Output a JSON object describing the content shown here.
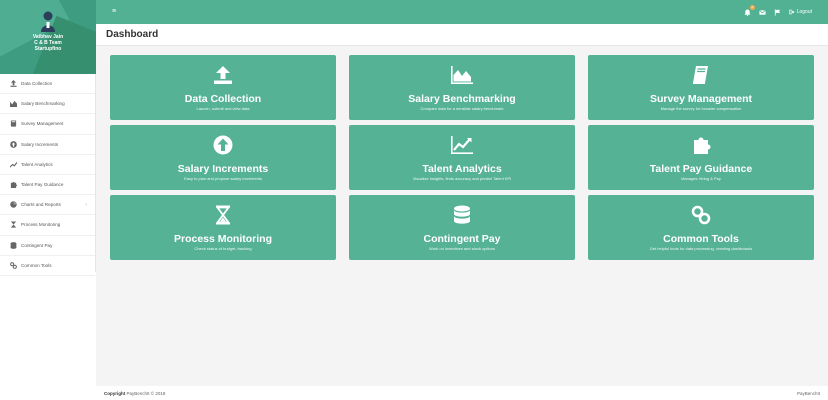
{
  "profile": {
    "name_line1": "Vaibhav Jain",
    "name_line2": "C & B Team",
    "name_line3": "Startupfino"
  },
  "sidebar": {
    "items": [
      {
        "label": "Data Collection",
        "icon": "upload-icon"
      },
      {
        "label": "Salary Benchmarking",
        "icon": "chart-icon"
      },
      {
        "label": "Survey Management",
        "icon": "book-icon"
      },
      {
        "label": "Salary Increments",
        "icon": "circle-up-icon"
      },
      {
        "label": "Talent Analytics",
        "icon": "trend-icon"
      },
      {
        "label": "Talent Pay Guidance",
        "icon": "puzzle-icon"
      },
      {
        "label": "Charts and Reports",
        "icon": "pie-icon",
        "has_submenu": true
      },
      {
        "label": "Process Monitoring",
        "icon": "hourglass-icon"
      },
      {
        "label": "Contingent Pay",
        "icon": "database-icon"
      },
      {
        "label": "Common Tools",
        "icon": "link-icon"
      }
    ],
    "submenu_chevron": "‹"
  },
  "topbar": {
    "menu_glyph": "≡",
    "notification_count": "4",
    "logout_label": "Logout"
  },
  "page": {
    "title": "Dashboard"
  },
  "cards": [
    {
      "title": "Data Collection",
      "desc": "Launch, submit and view data",
      "icon": "upload-icon"
    },
    {
      "title": "Salary Benchmarking",
      "desc": "Compare data for a sensible salary benchmark",
      "icon": "area-chart-icon"
    },
    {
      "title": "Survey Management",
      "desc": "Manage the survey for broader compensation",
      "icon": "book-icon"
    },
    {
      "title": "Salary Increments",
      "desc": "Easy to plan and propose salary increments",
      "icon": "arrow-circle-up-icon"
    },
    {
      "title": "Talent Analytics",
      "desc": "Visualize insights, finds accuracy and predict Talent KPI",
      "icon": "line-chart-icon"
    },
    {
      "title": "Talent Pay Guidance",
      "desc": "Manages Hiring & Pay",
      "icon": "puzzle-icon"
    },
    {
      "title": "Process Monitoring",
      "desc": "Check status of budget, tracking",
      "icon": "hourglass-icon"
    },
    {
      "title": "Contingent Pay",
      "desc": "Work on incentives and stock options",
      "icon": "database-icon"
    },
    {
      "title": "Common Tools",
      "desc": "Get helpful tools for data processing, creating dashboards",
      "icon": "link-icon"
    }
  ],
  "footer": {
    "copyright_bold": "Copyright",
    "copyright_rest": "PayBenchIt © 2018",
    "right_text": "PayBenchIt"
  },
  "colors": {
    "accent": "#52b193",
    "card": "#55b294",
    "sidebar_header": "#3e9c81"
  }
}
